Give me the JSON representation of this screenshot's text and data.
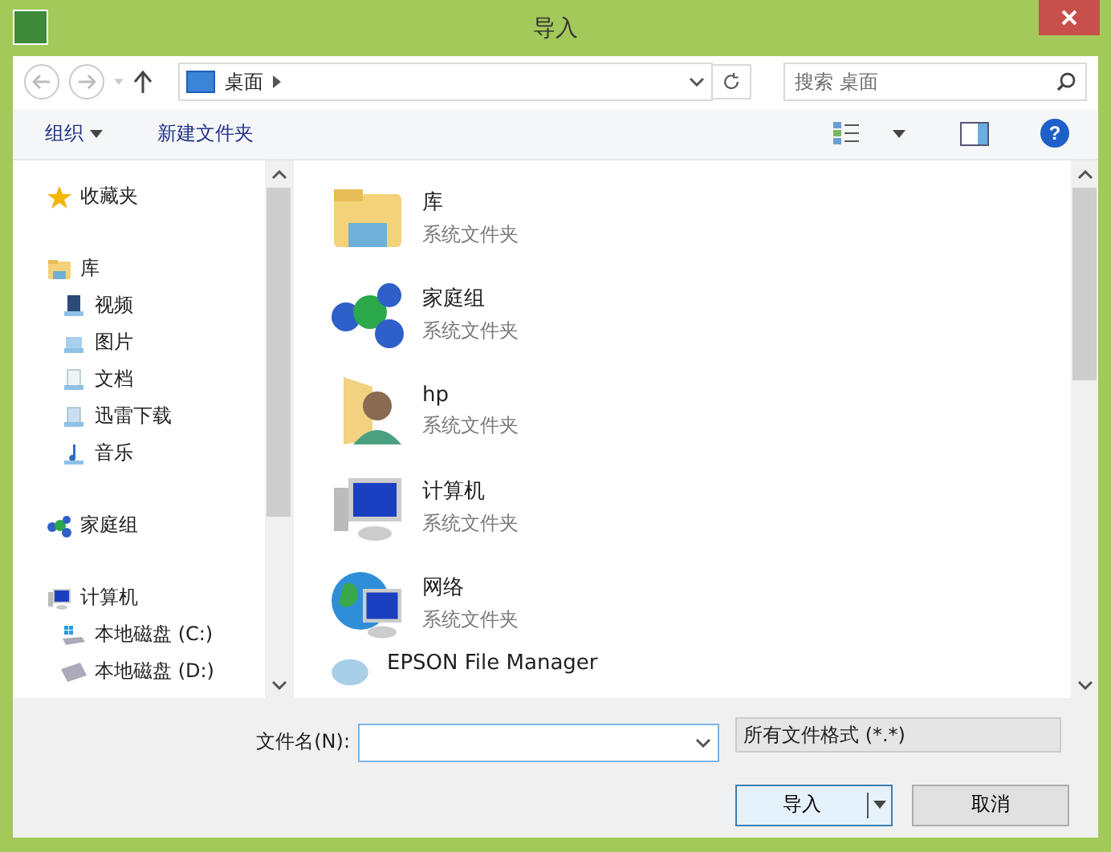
{
  "window": {
    "title": "导入"
  },
  "address_bar": {
    "location": "桌面"
  },
  "search": {
    "placeholder": "搜索 桌面"
  },
  "toolbar": {
    "organize": "组织",
    "new_folder": "新建文件夹",
    "help": "?"
  },
  "sidebar": {
    "items": [
      {
        "label": "收藏夹",
        "kind": "star"
      },
      {
        "label": "库",
        "kind": "library",
        "children": [
          {
            "label": "视频",
            "kind": "video"
          },
          {
            "label": "图片",
            "kind": "pictures"
          },
          {
            "label": "文档",
            "kind": "documents"
          },
          {
            "label": "迅雷下载",
            "kind": "download"
          },
          {
            "label": "音乐",
            "kind": "music"
          }
        ]
      },
      {
        "label": "家庭组",
        "kind": "homegroup"
      },
      {
        "label": "计算机",
        "kind": "computer",
        "children": [
          {
            "label": "本地磁盘 (C:)",
            "kind": "system-drive"
          },
          {
            "label": "本地磁盘 (D:)",
            "kind": "drive"
          }
        ]
      }
    ]
  },
  "items": [
    {
      "name": "库",
      "type": "系统文件夹",
      "kind": "library"
    },
    {
      "name": "家庭组",
      "type": "系统文件夹",
      "kind": "homegroup"
    },
    {
      "name": "hp",
      "type": "系统文件夹",
      "kind": "user"
    },
    {
      "name": "计算机",
      "type": "系统文件夹",
      "kind": "computer"
    },
    {
      "name": "网络",
      "type": "系统文件夹",
      "kind": "network"
    },
    {
      "name": "EPSON File Manager",
      "kind": "app"
    }
  ],
  "file_name": {
    "label": "文件名(N):"
  },
  "file_type": {
    "value": "所有文件格式 (*.*)"
  },
  "buttons": {
    "open": "导入",
    "cancel": "取消"
  }
}
